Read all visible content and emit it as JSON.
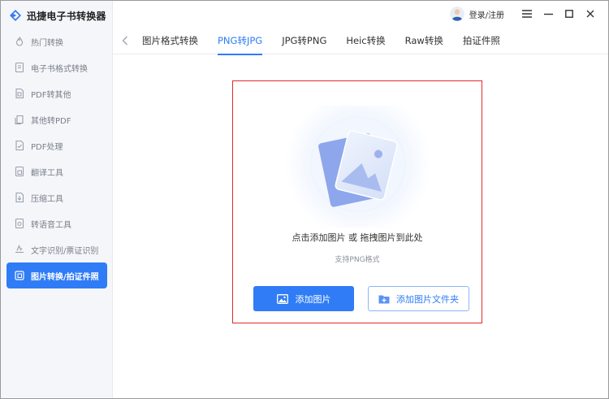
{
  "app": {
    "title": "迅捷电子书转换器"
  },
  "sidebar": {
    "items": [
      {
        "label": "热门转换",
        "icon": "hot-icon"
      },
      {
        "label": "电子书格式转换",
        "icon": "ebook-icon"
      },
      {
        "label": "PDF转其他",
        "icon": "pdf-convert-icon"
      },
      {
        "label": "其他转PDF",
        "icon": "to-pdf-icon"
      },
      {
        "label": "PDF处理",
        "icon": "pdf-process-icon"
      },
      {
        "label": "翻译工具",
        "icon": "translate-icon"
      },
      {
        "label": "压缩工具",
        "icon": "compress-icon"
      },
      {
        "label": "转语音工具",
        "icon": "voice-icon"
      },
      {
        "label": "文字识别/票证识别",
        "icon": "ocr-icon"
      },
      {
        "label": "图片转换/拍证件照",
        "icon": "image-convert-icon",
        "active": true
      }
    ]
  },
  "topbar": {
    "login_label": "登录/注册"
  },
  "tabs": [
    {
      "label": "图片格式转换"
    },
    {
      "label": "PNG转JPG",
      "active": true
    },
    {
      "label": "JPG转PNG"
    },
    {
      "label": "Heic转换"
    },
    {
      "label": "Raw转换"
    },
    {
      "label": "拍证件照"
    }
  ],
  "dropzone": {
    "instruction": "点击添加图片 或 拖拽图片到此处",
    "support": "支持PNG格式",
    "add_image_label": "添加图片",
    "add_folder_label": "添加图片文件夹"
  },
  "colors": {
    "accent": "#2f7cf6",
    "dropzone_border": "#e02a2a",
    "sidebar_bg": "#f4f6fa"
  }
}
